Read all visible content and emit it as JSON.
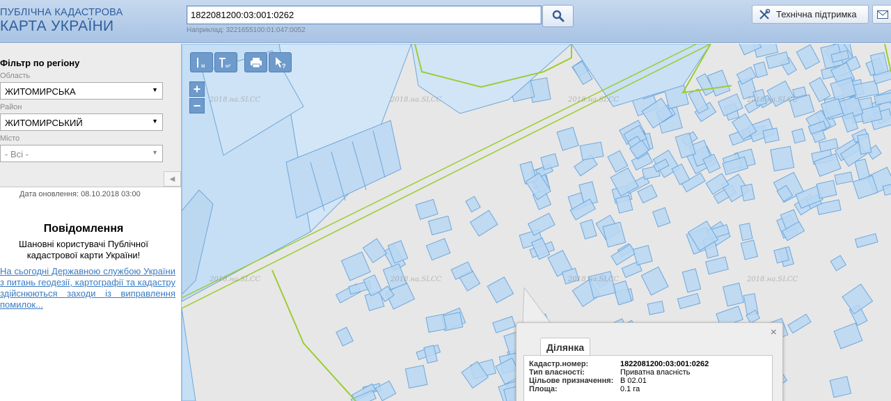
{
  "header": {
    "logo_line1": "ПУБЛІЧНА КАДАСТРОВА",
    "logo_line2": "КАРТА УКРАЇНИ",
    "search_value": "1822081200:03:001:0262",
    "search_hint": "Наприклад: 3221655100:01:047:0052",
    "support_label": "Технічна підтримка"
  },
  "filter": {
    "title": "Фільтр по регіону",
    "region_label": "Область",
    "region_value": "ЖИТОМИРСЬКА",
    "district_label": "Район",
    "district_value": "ЖИТОМИРСЬКИЙ",
    "city_label": "Місто",
    "city_value": "- Всі -"
  },
  "sidebar": {
    "update_date": "Дата оновлення: 08.10.2018 03:00",
    "notice_title": "Повідомлення",
    "notice_text": "Шановні користувачі Публічної кадастрової карти України!",
    "notice_link": "На сьогодні Державною службою України з питань геодезії, картографії та кадастру здійснюються заходи із виправлення помилок..."
  },
  "map": {
    "watermark": "2018.на.SLCC",
    "zoom_in": "+",
    "zoom_out": "−"
  },
  "popup": {
    "tab_label": "Ділянка",
    "close_symbol": "×",
    "rows": [
      {
        "key": "Кадастр.номер:",
        "value": "1822081200:03:001:0262"
      },
      {
        "key": "Тип власності:",
        "value": "Приватна власність"
      },
      {
        "key": "Цільове призначення:",
        "value": "В 02.01"
      },
      {
        "key": "Площа:",
        "value": "0.1 га"
      }
    ]
  },
  "colors": {
    "parcel_fill": "#b9d7f2",
    "parcel_stroke": "#6fa7dc",
    "boundary": "#9acd32",
    "header_blue": "#2e5e9d",
    "tool_blue": "#6e9bcb"
  }
}
